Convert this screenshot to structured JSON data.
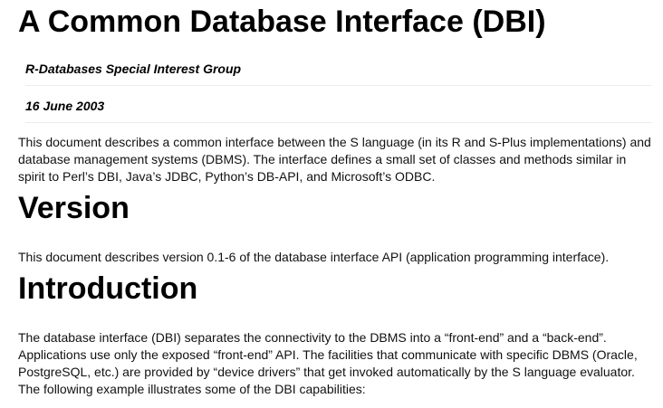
{
  "document": {
    "title": "A Common Database Interface (DBI)",
    "author": "R-Databases Special Interest Group",
    "date": "16 June 2003",
    "abstract": "This document describes a common interface between the S language (in its R and S-Plus implementations) and database management systems (DBMS). The interface defines a small set of classes and methods similar in spirit to Perl’s DBI, Java’s JDBC, Python’s DB-API, and Microsoft’s ODBC."
  },
  "sections": {
    "version": {
      "heading": "Version",
      "text": "This document describes version 0.1-6 of the database interface API (application programming interface)."
    },
    "introduction": {
      "heading": "Introduction",
      "text": "The database interface (DBI) separates the connectivity to the DBMS into a “front-end” and a “back-end”. Applications use only the exposed “front-end” API. The facilities that communicate with specific DBMS (Oracle, PostgreSQL, etc.) are provided by “device drivers” that get invoked automatically by the S language evaluator. The following example illustrates some of the DBI capabilities:"
    }
  }
}
